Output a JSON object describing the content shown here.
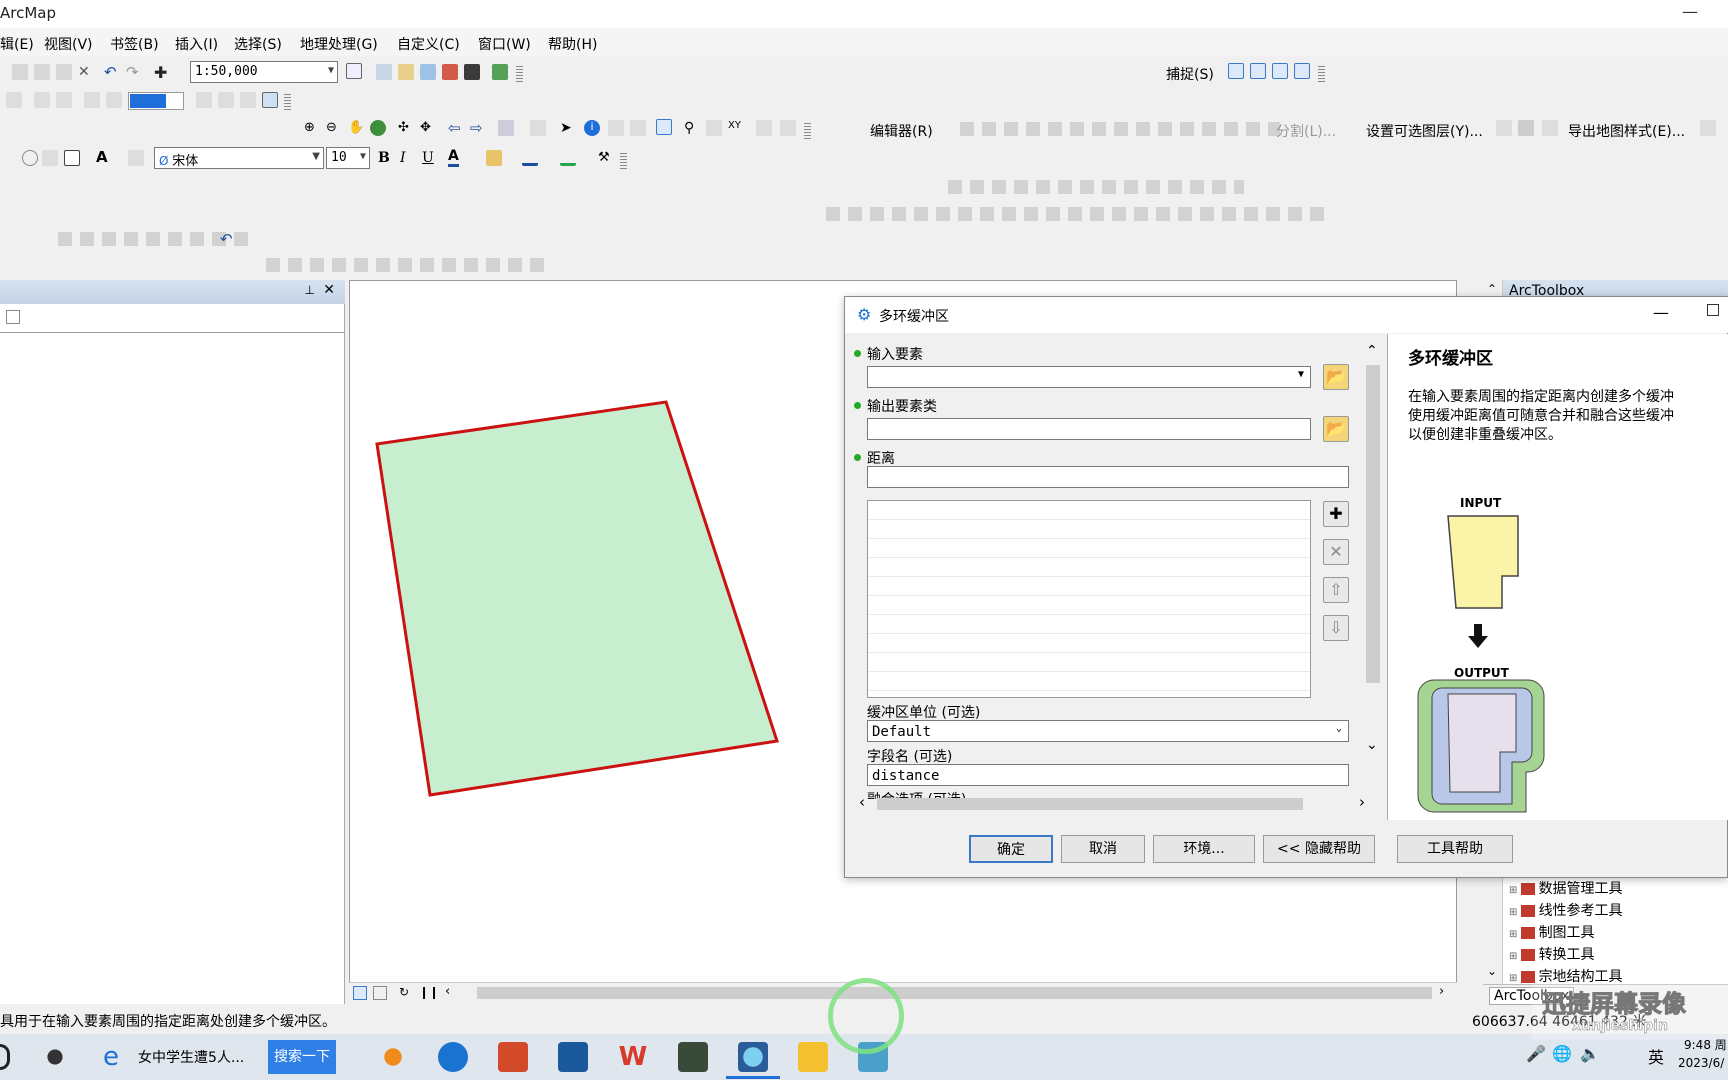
{
  "window": {
    "title": "ArcMap"
  },
  "menu": {
    "items": [
      "辑(E)",
      "视图(V)",
      "书签(B)",
      "插入(I)",
      "选择(S)",
      "地理处理(G)",
      "自定义(C)",
      "窗口(W)",
      "帮助(H)"
    ]
  },
  "toolbar": {
    "scale": "1:50,000",
    "snapping_label": "捕捉(S)",
    "editor_label": "编辑器(R)",
    "split_label": "分割(L)...",
    "set_selectable_label": "设置可选图层(Y)...",
    "export_style_label": "导出地图样式(E)...",
    "font_name": "宋体",
    "font_size": "10",
    "bold": "B",
    "italic": "I",
    "underline": "U",
    "text_color": "A"
  },
  "colors": {
    "polygon_fill": "#c8eed0",
    "polygon_stroke": "#cc1111",
    "required_dot": "#22aa22",
    "accent": "#1e6fd9"
  },
  "map": {
    "polygon": "selected-parcel"
  },
  "dialog": {
    "title": "多环缓冲区",
    "input_features_label": "输入要素",
    "input_features_value": "",
    "output_class_label": "输出要素类",
    "output_class_value": "",
    "distance_label": "距离",
    "distance_value": "",
    "buffer_unit_label": "缓冲区单位 (可选)",
    "buffer_unit_value": "Default",
    "field_name_label": "字段名 (可选)",
    "field_name_value": "distance",
    "dissolve_label": "融合选项 (可选)",
    "ok": "确定",
    "cancel": "取消",
    "environments": "环境...",
    "hide_help": "<< 隐藏帮助",
    "tool_help": "工具帮助"
  },
  "help": {
    "title": "多环缓冲区",
    "lines": [
      "在输入要素周围的指定距离内创建多个缓冲",
      "使用缓冲距离值可随意合并和融合这些缓冲",
      "以便创建非重叠缓冲区。"
    ],
    "input_label": "INPUT",
    "output_label": "OUTPUT"
  },
  "arctoolbox": {
    "title": "ArcToolbox",
    "items": [
      "数据管理工具",
      "线性参考工具",
      "制图工具",
      "转换工具",
      "宗地结构工具"
    ],
    "tab": "ArcToolbox"
  },
  "status": {
    "message": "具用于在输入要素周围的指定距离处创建多个缓冲区。",
    "coords": "606637.64  46461.432 米"
  },
  "taskbar": {
    "browser_tab": "女中学生遭5人...",
    "search_button": "搜索一下",
    "ime": "英",
    "time": "9:48 周",
    "date": "2023/6/"
  },
  "watermark": "迅捷屏幕录像",
  "watermark_url": "xunjieshipin"
}
